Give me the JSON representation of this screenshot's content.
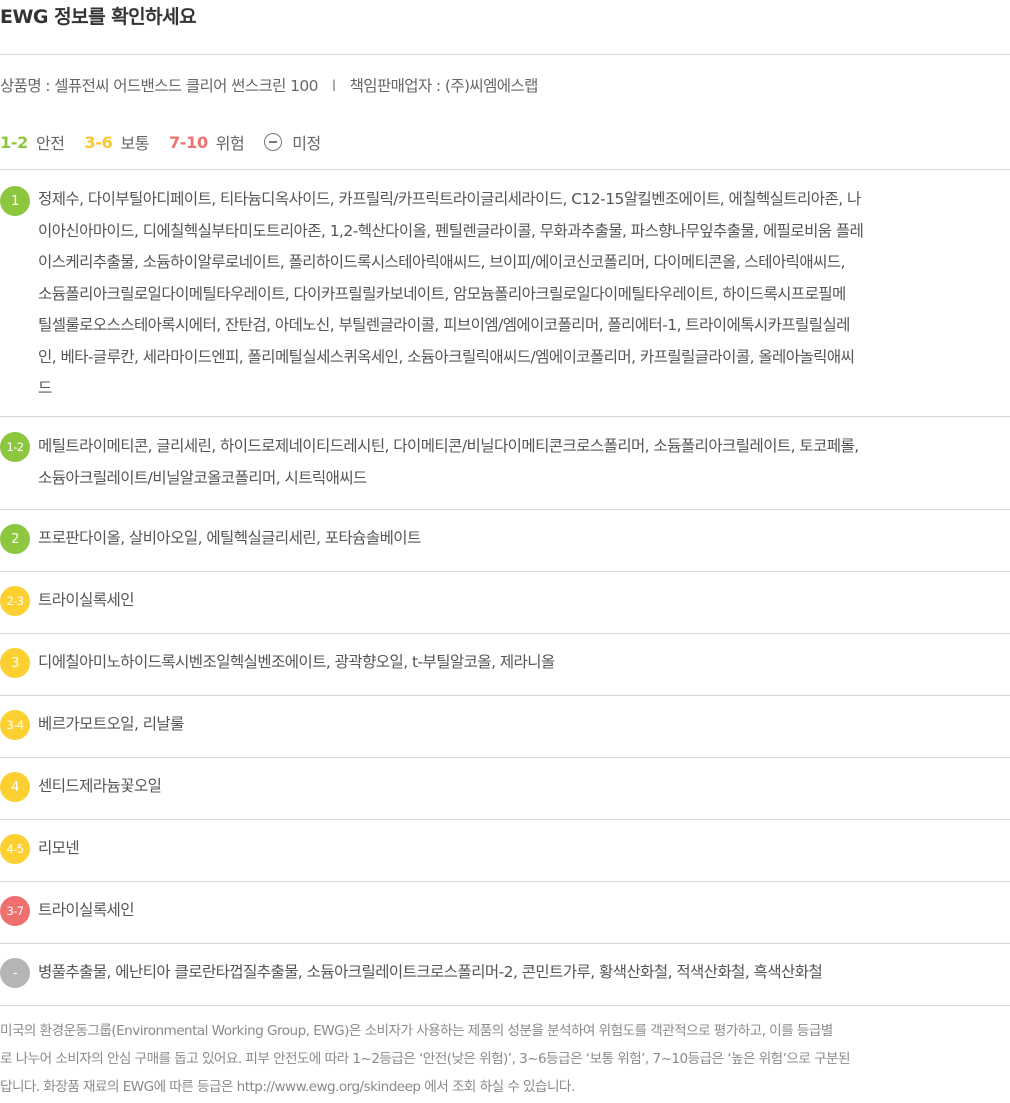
{
  "header": {
    "title": "EWG 정보를 확인하세요"
  },
  "product": {
    "name_text": "상품명 : 셀퓨전씨 어드밴스드 클리어 썬스크린 100",
    "separator": "l",
    "maker_text": "책임판매업자 : (주)씨엠에스랩"
  },
  "legend": {
    "safe_range": "1-2",
    "safe_label": "안전",
    "moderate_range": "3-6",
    "moderate_label": "보통",
    "high_range": "7-10",
    "high_label": "위험",
    "undetermined_label": "미정"
  },
  "colors": {
    "green": "#8dc63f",
    "yellow": "#fdd032",
    "red": "#f07070",
    "grey": "#b5b5b5"
  },
  "grades": [
    {
      "badge": "1",
      "color": "green",
      "lines": [
        "정제수, 다이부틸아디페이트, 티타늄디옥사이드, 카프릴릭/카프릭트라이글리세라이드, C12-15알킬벤조에이트, 에칠헥실트리아존, 나",
        "이아신아마이드, 디에칠헥실부타미도트리아존, 1,2-헥산다이올, 펜틸렌글라이콜, 무화과추출물, 파스향나무잎추출물, 에필로비움 플레",
        "이스케리추출물, 소듐하이알루로네이트, 폴리하이드록시스테아릭애씨드, 브이피/에이코신코폴리머, 다이메티콘올, 스테아릭애씨드,",
        "소듐폴리아크릴로일다이메틸타우레이트, 다이카프릴릴카보네이트, 암모늄폴리아크릴로일다이메틸타우레이트, 하이드록시프로필메",
        "틸셀룰로오스스테아록시에터, 잔탄검, 아데노신, 부틸렌글라이콜, 피브이엠/엠에이코폴리머, 폴리에터-1, 트라이에톡시카프릴릴실레",
        "인, 베타-글루칸, 세라마이드엔피, 폴리메틸실세스퀴옥세인, 소듐아크릴릭애씨드/엠에이코폴리머, 카프릴릴글라이콜, 올레아놀릭애씨",
        "드"
      ]
    },
    {
      "badge": "1-2",
      "color": "green",
      "lines": [
        "메틸트라이메티콘, 글리세린, 하이드로제네이티드레시틴, 다이메티콘/비닐다이메티콘크로스폴리머, 소듐폴리아크릴레이트, 토코페롤,",
        "소듐아크릴레이트/비닐알코올코폴리머, 시트릭애씨드"
      ]
    },
    {
      "badge": "2",
      "color": "green",
      "lines": [
        "프로판다이올, 살비아오일, 에틸헥실글리세린, 포타슘솔베이트"
      ]
    },
    {
      "badge": "2-3",
      "color": "yellow",
      "lines": [
        "트라이실록세인"
      ]
    },
    {
      "badge": "3",
      "color": "yellow",
      "lines": [
        "디에칠아미노하이드록시벤조일헥실벤조에이트, 광곽향오일, t-부틸알코올, 제라니올"
      ]
    },
    {
      "badge": "3-4",
      "color": "yellow",
      "lines": [
        "베르가모트오일, 리날룰"
      ]
    },
    {
      "badge": "4",
      "color": "yellow",
      "lines": [
        "센티드제라늄꽃오일"
      ]
    },
    {
      "badge": "4-5",
      "color": "yellow",
      "lines": [
        "리모넨"
      ]
    },
    {
      "badge": "3-7",
      "color": "red",
      "lines": [
        "트라이실록세인"
      ]
    },
    {
      "badge": "-",
      "color": "grey",
      "lines": [
        "병풀추출물, 에난티아 클로란타껍질추출물, 소듐아크릴레이트크로스폴리머-2, 콘민트가루, 황색산화철, 적색산화철, 흑색산화철"
      ]
    }
  ],
  "footer": {
    "lines": [
      "미국의 환경운동그룹(Environmental Working Group, EWG)은 소비자가 사용하는 제품의 성분을 분석하여 위험도를 객관적으로 평가하고, 이를 등급별",
      "로 나누어 소비자의 안심 구매를 돕고 있어요. 피부 안전도에 따라 1~2등급은 ‘안전(낮은 위험)’, 3~6등급은 ‘보통 위험’, 7~10등급은 ‘높은 위험’으로 구분된",
      "답니다. 화장품 재료의 EWG에 따른 등급은 http://www.ewg.org/skindeep 에서 조회 하실 수 있습니다."
    ]
  }
}
